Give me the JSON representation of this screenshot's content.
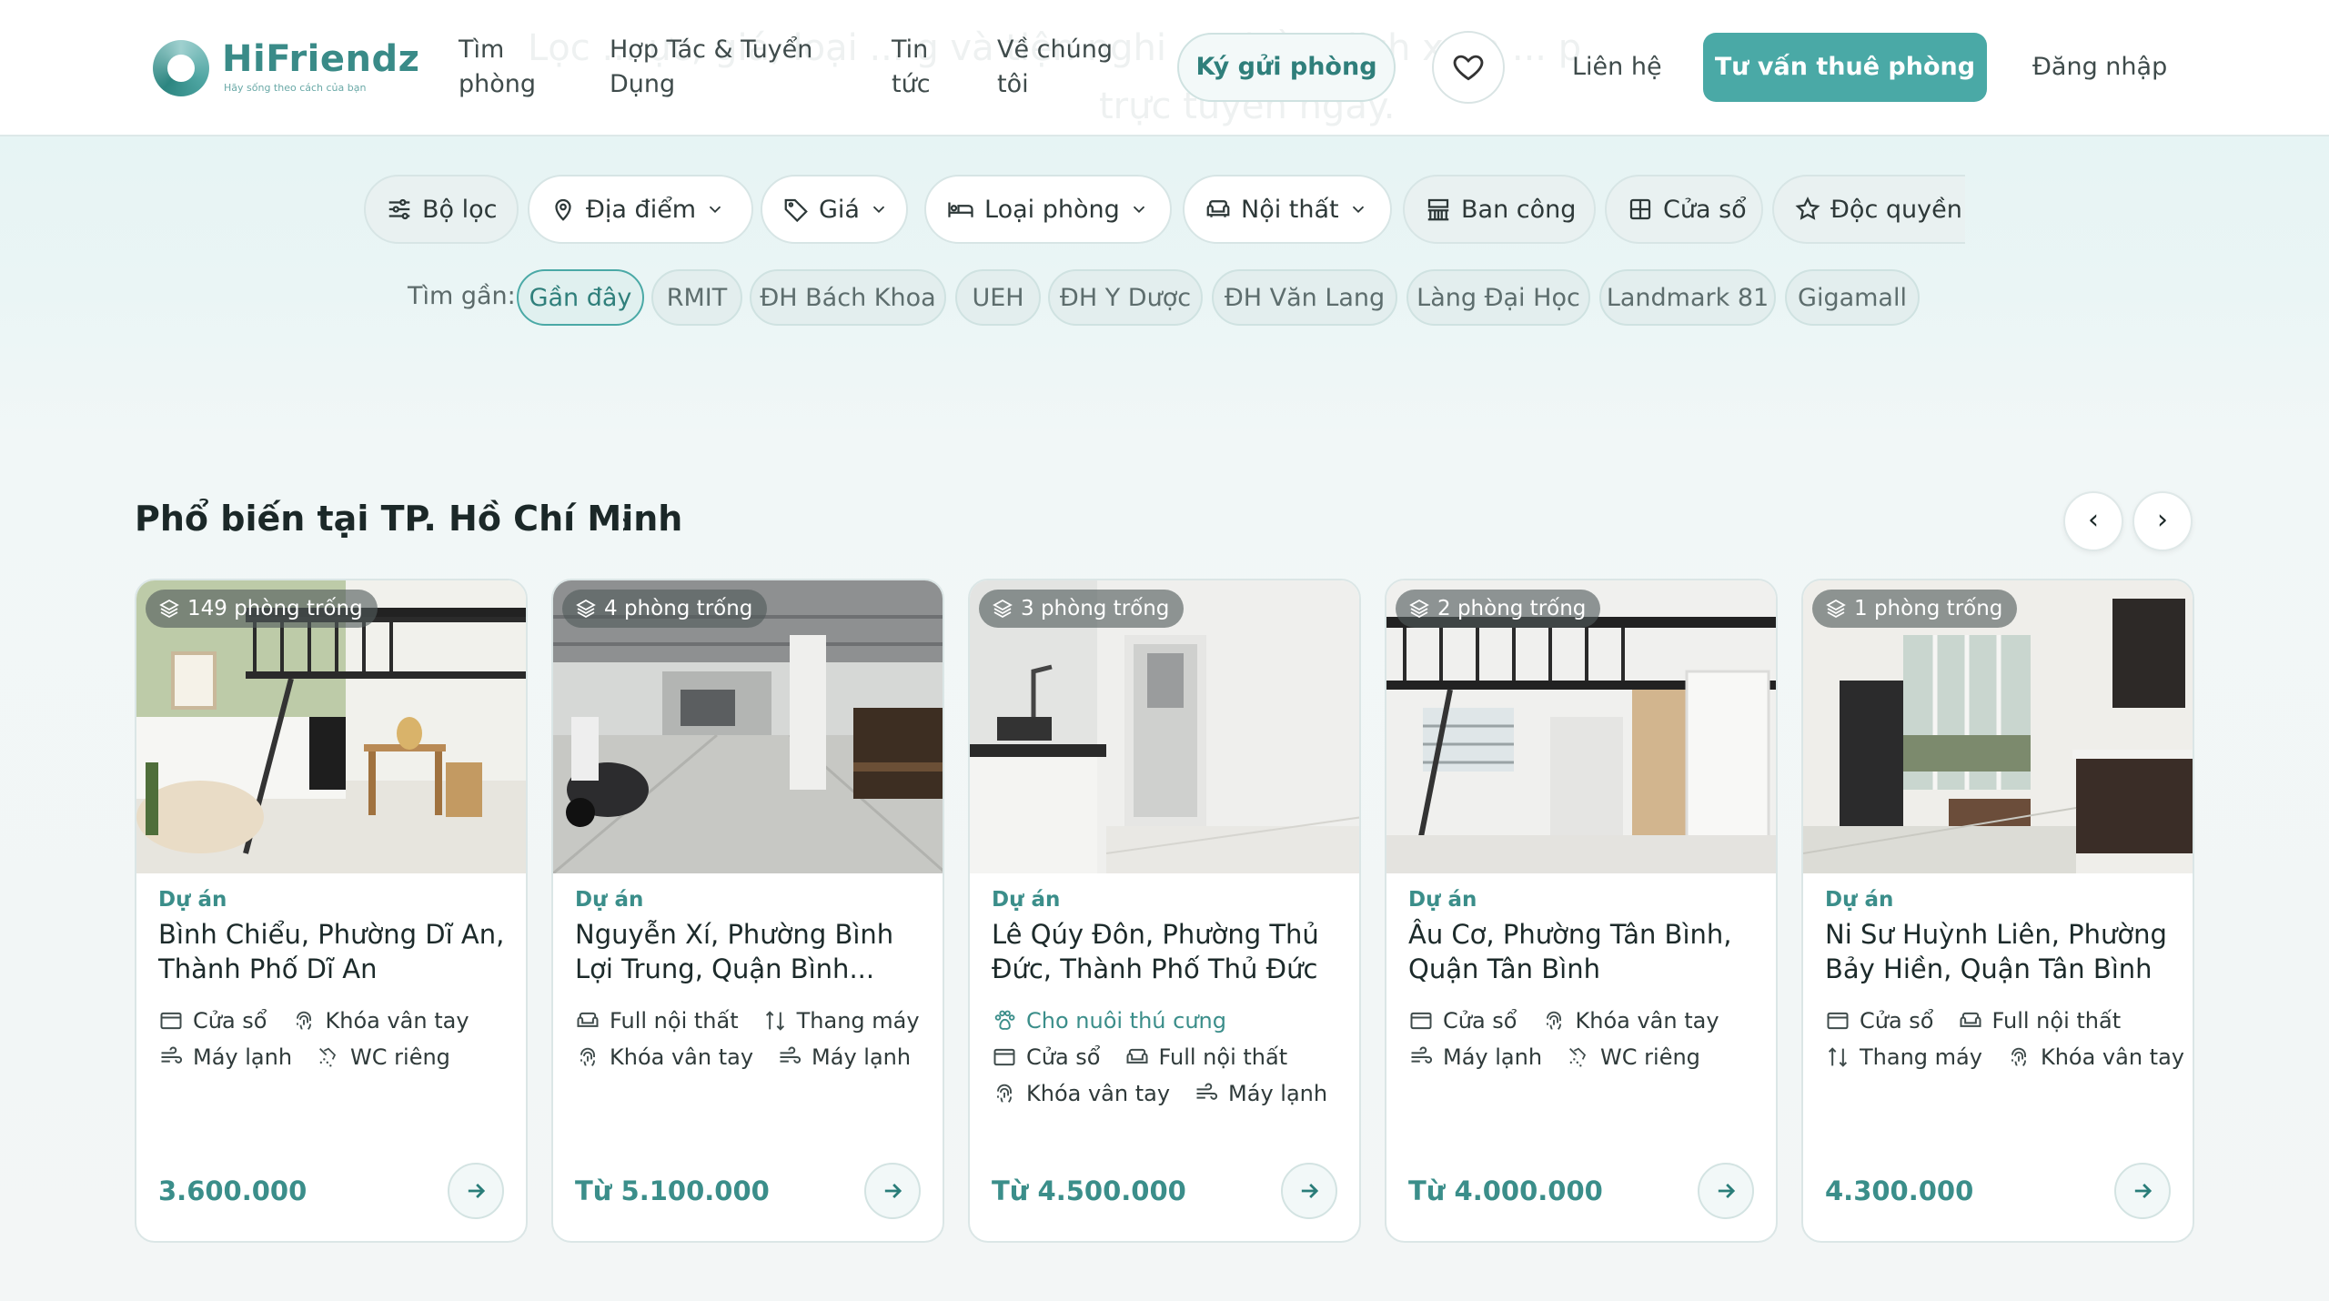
{
  "brand": {
    "name": "HiFriendz",
    "tagline": "Hãy sống theo cách của bạn"
  },
  "nav": {
    "tim_phong": [
      "Tìm",
      "phòng"
    ],
    "hop_tac": [
      "Hợp Tác & Tuyển",
      "Dụng"
    ],
    "tin_tuc": [
      "Tin",
      "tức"
    ],
    "ve_chung_toi": [
      "Về chúng",
      "tôi"
    ],
    "ky_gui": "Ký gửi phòng",
    "lien_he": "Liên hệ",
    "tu_van": "Tư vấn thuê phòng",
    "dang_nhap": "Đăng nhập"
  },
  "hero_ghost": {
    "line1": "Lọc ... ực, giá, loại ... g và tiện nghi ... chồng lịch xem ... p",
    "line2": "trực tuyến ngay."
  },
  "filters": [
    "Bộ lọc",
    "Địa điểm",
    "Giá",
    "Loại phòng",
    "Nội thất",
    "Ban công",
    "Cửa sổ",
    "Độc quyền"
  ],
  "near": {
    "label": "Tìm gần:",
    "items": [
      "Gần đây",
      "RMIT",
      "ĐH Bách Khoa",
      "UEH",
      "ĐH Y Dược",
      "ĐH Văn Lang",
      "Làng Đại Học",
      "Landmark 81",
      "Gigamall"
    ],
    "active": "Gần đây"
  },
  "section": {
    "title": "Phổ biến tại TP. Hồ Chí Minh",
    "chevron": "›",
    "prev": "‹",
    "next": "›"
  },
  "cards": [
    {
      "badge": "149 phòng trống",
      "kind": "Dự án",
      "addr": [
        "Bình Chiểu, Phường Dĩ An,",
        "Thành Phố Dĩ An"
      ],
      "amen": [
        [
          "Cửa sổ",
          "Khóa vân tay"
        ],
        [
          "Máy lạnh",
          "WC riêng"
        ]
      ],
      "price": "3.600.000"
    },
    {
      "badge": "4 phòng trống",
      "kind": "Dự án",
      "addr": [
        "Nguyễn Xí, Phường Bình",
        "Lợi Trung, Quận Bình..."
      ],
      "amen": [
        [
          "Full nội thất",
          "Thang máy"
        ],
        [
          "Khóa vân tay",
          "Máy lạnh"
        ]
      ],
      "price": "Từ 5.100.000"
    },
    {
      "badge": "3 phòng trống",
      "kind": "Dự án",
      "addr": [
        "Lê Qúy Đôn, Phường Thủ",
        "Đức, Thành Phố Thủ Đức"
      ],
      "amen": [
        [
          "Cho nuôi thú cưng"
        ],
        [
          "Cửa sổ",
          "Full nội thất"
        ],
        [
          "Khóa vân tay",
          "Máy lạnh"
        ]
      ],
      "price": "Từ 4.500.000"
    },
    {
      "badge": "2 phòng trống",
      "kind": "Dự án",
      "addr": [
        "Âu Cơ, Phường Tân Bình,",
        "Quận Tân Bình"
      ],
      "amen": [
        [
          "Cửa sổ",
          "Khóa vân tay"
        ],
        [
          "Máy lạnh",
          "WC riêng"
        ]
      ],
      "price": "Từ 4.000.000"
    },
    {
      "badge": "1 phòng trống",
      "kind": "Dự án",
      "addr": [
        "Ni Sư Huỳnh Liên, Phường",
        "Bảy Hiền, Quận Tân Bình"
      ],
      "amen": [
        [
          "Cửa sổ",
          "Full nội thất"
        ],
        [
          "Thang máy",
          "Khóa vân tay"
        ]
      ],
      "price": "4.300.000"
    }
  ]
}
